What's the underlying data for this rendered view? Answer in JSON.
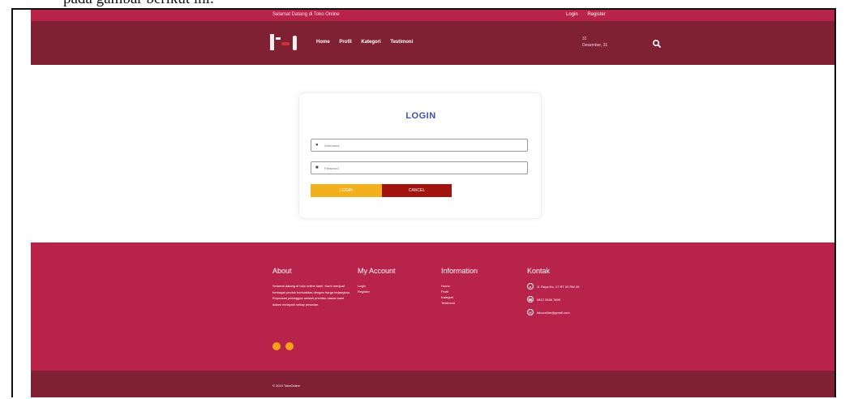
{
  "caption": "pada gambar berikut ini.",
  "topbar": {
    "welcome": "Selamat Datang di Toko Online",
    "links": [
      "Login",
      "Register"
    ]
  },
  "navbar": {
    "menu": [
      "Home",
      "Profil",
      "Kategori",
      "Testimoni"
    ],
    "date_day": "31",
    "date_label": "Desember, 31",
    "search_icon": "search-icon"
  },
  "login": {
    "title": "LOGIN",
    "username_placeholder": "Username",
    "password_placeholder": "Password",
    "login_button": "LOGIN",
    "cancel_button": "CANCEL"
  },
  "footer": {
    "about_title": "About",
    "about_text": "Selamat datang di toko online kami. Kami menjual berbagai produk berkualitas dengan harga terjangkau. Kepuasan pelanggan adalah prioritas utama kami dalam melayani setiap pesanan.",
    "account_title": "My Account",
    "account_links": [
      "Login",
      "Register"
    ],
    "info_title": "Information",
    "info_links": [
      "Home",
      "Profil",
      "Kategori",
      "Testimoni"
    ],
    "kontak_title": "Kontak",
    "kontak": {
      "address": "Jl. Raya No. 17 RT 03 RW 05",
      "phone": "0812 3456 7890",
      "email": "tokoonline@gmail.com"
    }
  },
  "bottom": {
    "copyright": "© 2019 TokoOnline"
  },
  "colors": {
    "accent": "#b8234a",
    "dark": "#7f2133",
    "login_btn": "#f1b01c",
    "cancel_btn": "#a0130f",
    "title": "#3a4fb4"
  }
}
